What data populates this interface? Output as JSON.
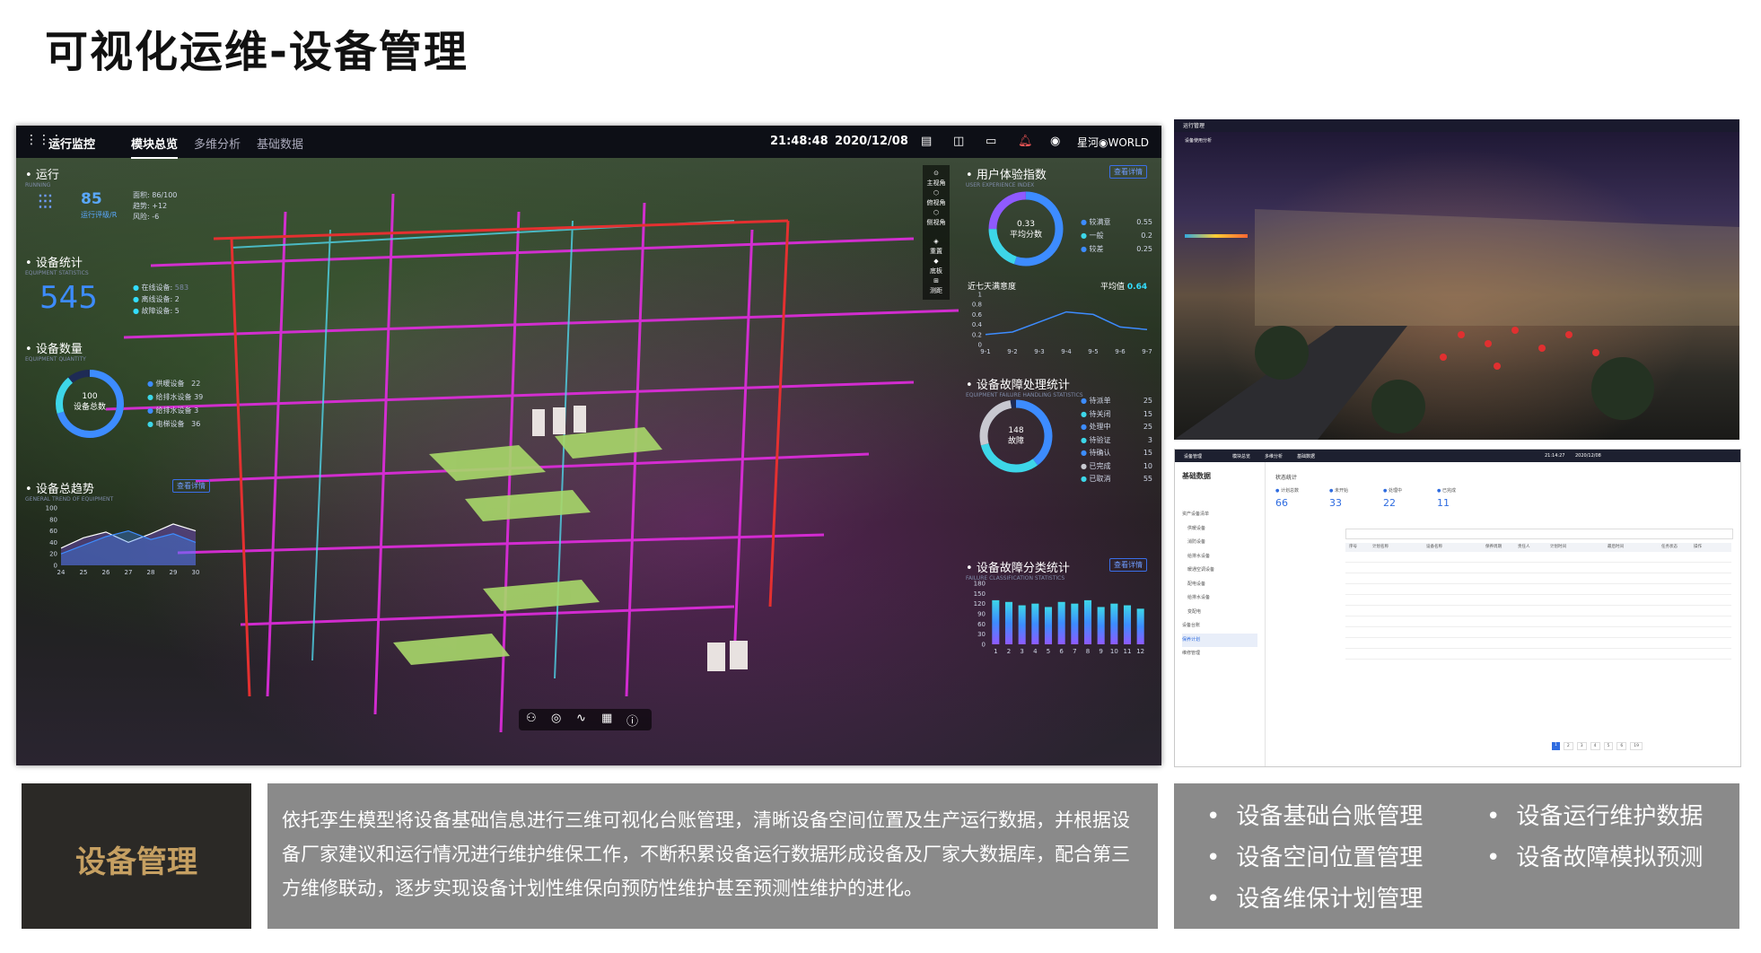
{
  "page_title": "可视化运维-设备管理",
  "dashboard": {
    "topbar": {
      "title": "运行监控",
      "tabs": [
        "模块总览",
        "多维分析",
        "基础数据"
      ],
      "active_tab": "模块总览",
      "time": "21:48:48",
      "date": "2020/12/08",
      "brand": "星河◉WORLD"
    },
    "running": {
      "title": "运行",
      "subtitle": "RUNNING",
      "score": "85",
      "score_label": "运行评级/R",
      "stats": [
        "面积: 86/100",
        "趋势: +12",
        "风险: -6"
      ]
    },
    "equipment_stats": {
      "title": "设备统计",
      "subtitle": "EQUIPMENT STATISTICS",
      "total": "545",
      "items": [
        {
          "label": "在线设备:",
          "value": "583"
        },
        {
          "label": "离线设备:",
          "value": "2"
        },
        {
          "label": "故障设备:",
          "value": "5"
        }
      ]
    },
    "equipment_quantity": {
      "title": "设备数量",
      "subtitle": "EQUIPMENT QUANTITY",
      "center_value": "100",
      "center_label": "设备总数",
      "items": [
        {
          "label": "供暖设备",
          "value": "22"
        },
        {
          "label": "给排水设备",
          "value": "39"
        },
        {
          "label": "给排水设备",
          "value": "3"
        },
        {
          "label": "电梯设备",
          "value": "36"
        }
      ]
    },
    "trend": {
      "title": "设备总趋势",
      "subtitle": "GENERAL TREND OF EQUIPMENT",
      "button": "查看详情"
    },
    "ux": {
      "title": "用户体验指数",
      "subtitle": "USER EXPERIENCE INDEX",
      "button": "查看详情",
      "score": "0.33",
      "score_label": "平均分数",
      "legend": [
        {
          "label": "较满意",
          "value": "0.55"
        },
        {
          "label": "一般",
          "value": "0.2"
        },
        {
          "label": "较差",
          "value": "0.25"
        }
      ],
      "line_title": "近七天满意度",
      "avg_label": "平均值",
      "avg_value": "0.64"
    },
    "fault_handling": {
      "title": "设备故障处理统计",
      "subtitle": "EQUIPMENT FAILURE HANDLING STATISTICS",
      "center_value": "148",
      "center_label": "故障",
      "items": [
        {
          "label": "待派单",
          "value": "25"
        },
        {
          "label": "待关闭",
          "value": "15"
        },
        {
          "label": "处理中",
          "value": "25"
        },
        {
          "label": "待验证",
          "value": "3"
        },
        {
          "label": "待确认",
          "value": "15"
        },
        {
          "label": "已完成",
          "value": "10"
        },
        {
          "label": "已取消",
          "value": "55"
        }
      ]
    },
    "fault_class": {
      "title": "设备故障分类统计",
      "subtitle": "FAILURE CLASSIFICATION STATISTICS",
      "button": "查看详情"
    },
    "view_tools": [
      "主视角",
      "俯视角",
      "侧视角",
      "重置",
      "底板",
      "测距"
    ]
  },
  "chart_data": [
    {
      "type": "area",
      "title": "设备总趋势",
      "x": [
        "24",
        "25",
        "26",
        "27",
        "28",
        "29",
        "30"
      ],
      "yticks": [
        "100",
        "80",
        "60",
        "40",
        "20",
        "0"
      ],
      "ylim": [
        0,
        100
      ],
      "series": [
        {
          "values": [
            30,
            48,
            58,
            40,
            55,
            72,
            60
          ]
        },
        {
          "values": [
            20,
            35,
            50,
            60,
            45,
            55,
            40
          ]
        }
      ]
    },
    {
      "type": "line",
      "title": "近七天满意度",
      "x": [
        "9-1",
        "9-2",
        "9-3",
        "9-4",
        "9-5",
        "9-6",
        "9-7"
      ],
      "yticks": [
        "1",
        "0.8",
        "0.6",
        "0.4",
        "0.2",
        "0"
      ],
      "ylim": [
        0,
        1
      ],
      "values": [
        0.2,
        0.25,
        0.45,
        0.65,
        0.6,
        0.35,
        0.3
      ]
    },
    {
      "type": "bar",
      "title": "设备故障分类统计",
      "categories": [
        "1",
        "2",
        "3",
        "4",
        "5",
        "6",
        "7",
        "8",
        "9",
        "10",
        "11",
        "12"
      ],
      "yticks": [
        "180",
        "150",
        "120",
        "90",
        "60",
        "30",
        "0"
      ],
      "ylim": [
        0,
        180
      ],
      "values": [
        130,
        125,
        115,
        120,
        110,
        125,
        120,
        130,
        110,
        120,
        115,
        105
      ]
    }
  ],
  "shot2": {
    "title": "运行管理",
    "labels": [
      "设备使用分析"
    ]
  },
  "shot3": {
    "title": "设备管理",
    "tabs": [
      "模块总览",
      "多维分析",
      "基础数据"
    ],
    "time": "21:14:27",
    "date": "2020/12/08",
    "sidebar_title": "基础数据",
    "sidebar_items": [
      "资产设备清单",
      "供暖设备",
      "消防设备",
      "给排水设备",
      "暖通空调设备",
      "配电设备",
      "给排水设备",
      "变配电",
      "设备台账",
      "保养计划",
      "维修管理"
    ],
    "status_title": "状态统计",
    "stats": [
      {
        "label": "计划总数",
        "value": "66"
      },
      {
        "label": "未开始",
        "value": "33"
      },
      {
        "label": "处理中",
        "value": "22"
      },
      {
        "label": "已完成",
        "value": "11"
      }
    ],
    "table_headers": [
      "序号",
      "计划名称",
      "设备名称",
      "保养周期",
      "责任人",
      "计划时间",
      "最后时间",
      "任务状态",
      "操作"
    ],
    "pagination": [
      "1",
      "2",
      "3",
      "4",
      "5",
      "6",
      "19"
    ]
  },
  "bottom": {
    "label": "设备管理",
    "description": "依托孪生模型将设备基础信息进行三维可视化台账管理，清晰设备空间位置及生产运行数据，并根据设备厂家建议和运行情况进行维护维保工作，不断积累设备运行数据形成设备及厂家大数据库，配合第三方维修联动，逐步实现设备计划性维保向预防性维护甚至预测性维护的进化。",
    "features": [
      "设备基础台账管理",
      "设备运行维护数据",
      "设备空间位置管理",
      "设备故障模拟预测",
      "设备维保计划管理"
    ]
  }
}
